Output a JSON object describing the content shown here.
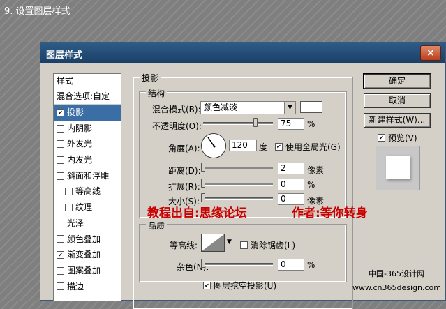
{
  "step_caption": "9. 设置图层样式",
  "dialog": {
    "title": "图层样式",
    "close_label": "×"
  },
  "styles_panel": {
    "header": "样式",
    "blend_options": "混合选项:自定",
    "items": [
      {
        "label": "投影",
        "checked": true,
        "selected": true
      },
      {
        "label": "内阴影",
        "checked": false
      },
      {
        "label": "外发光",
        "checked": false
      },
      {
        "label": "内发光",
        "checked": false
      },
      {
        "label": "斜面和浮雕",
        "checked": false
      },
      {
        "label": "等高线",
        "checked": false,
        "indent": true
      },
      {
        "label": "纹理",
        "checked": false,
        "indent": true
      },
      {
        "label": "光泽",
        "checked": false
      },
      {
        "label": "颜色叠加",
        "checked": false
      },
      {
        "label": "渐变叠加",
        "checked": true
      },
      {
        "label": "图案叠加",
        "checked": false
      },
      {
        "label": "描边",
        "checked": false
      }
    ]
  },
  "drop_shadow": {
    "section_title": "投影",
    "structure_title": "结构",
    "blend_mode_label": "混合模式(B):",
    "blend_mode_value": "颜色减淡",
    "opacity_label": "不透明度(O):",
    "opacity_value": "75",
    "opacity_unit": "%",
    "angle_label": "角度(A):",
    "angle_value": "120",
    "angle_unit": "度",
    "global_light_label": "使用全局光(G)",
    "global_light_checked": true,
    "distance_label": "距离(D):",
    "distance_value": "2",
    "distance_unit": "像素",
    "spread_label": "扩展(R):",
    "spread_value": "0",
    "spread_unit": "%",
    "size_label": "大小(S):",
    "size_value": "0",
    "size_unit": "像素",
    "quality_title": "品质",
    "contour_label": "等高线:",
    "antialias_label": "消除锯齿(L)",
    "antialias_checked": false,
    "noise_label": "杂色(N):",
    "noise_value": "0",
    "noise_unit": "%",
    "knockout_label": "图层挖空投影(U)",
    "knockout_checked": true
  },
  "buttons": {
    "ok": "确定",
    "cancel": "取消",
    "new_style": "新建样式(W)...",
    "preview_label": "预览(V)",
    "preview_checked": true
  },
  "watermarks": {
    "source": "教程出自:思缘论坛",
    "author": "作者:等你转身"
  },
  "site_credit": {
    "line1": "中国-365设计网",
    "line2": "www.cn365design.com"
  },
  "colors": {
    "titlebar": "#1a3f66",
    "selection": "#3a6ea5",
    "watermark": "#cc0000",
    "dialog_face": "#d4d0c8"
  }
}
